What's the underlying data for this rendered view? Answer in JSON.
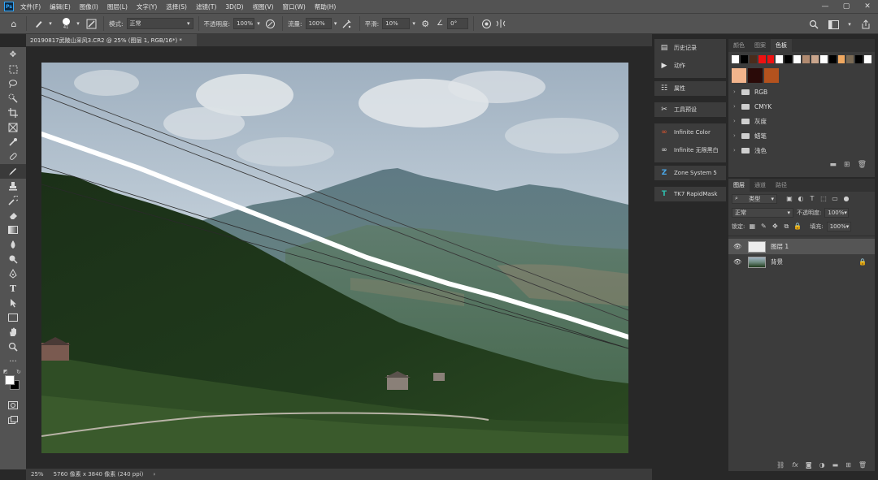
{
  "menubar": {
    "logo": "Ps",
    "items": [
      "文件(F)",
      "编辑(E)",
      "图像(I)",
      "图层(L)",
      "文字(Y)",
      "选择(S)",
      "滤镜(T)",
      "3D(D)",
      "视图(V)",
      "窗口(W)",
      "帮助(H)"
    ],
    "window_controls": [
      "—",
      "▢",
      "✕"
    ]
  },
  "options": {
    "brush_size": "41",
    "mode_label": "模式:",
    "mode_value": "正常",
    "opacity_label": "不透明度:",
    "opacity_value": "100%",
    "flow_label": "流量:",
    "flow_value": "100%",
    "smooth_label": "平滑:",
    "smooth_value": "10%",
    "angle_value": "0°"
  },
  "document": {
    "tab_title": "20190817武陵山采风3.CR2 @ 25% (图层 1, RGB/16*) *",
    "zoom": "25%",
    "info": "5760 像素 x 3840 像素 (240 ppi)"
  },
  "dock": {
    "history": "历史记录",
    "actions": "动作",
    "properties": "属性",
    "tool_presets": "工具预设",
    "infinite_color": "Infinite Color",
    "infinite_bw": "Infinite 无限黑白",
    "zone_system": "Zone System 5",
    "tk7": "TK7 RapidMask"
  },
  "swatches_panel": {
    "tabs": [
      "颜色",
      "图案",
      "色板"
    ],
    "active_tab": 2,
    "row": [
      "#ffffff",
      "#000000",
      "#4a2c1c",
      "#ee1111",
      "#ee1111",
      "#ffffff",
      "#000000",
      "#ffffff",
      "#b08a70",
      "#c9a58c",
      "#ffffff",
      "#000000",
      "#f0a860",
      "#7a6a55",
      "#000000",
      "#ffffff"
    ],
    "recent": [
      "#f2b48c",
      "#2a0a08",
      "#b4521e"
    ],
    "folders": [
      "RGB",
      "CMYK",
      "灰度",
      "蜡笔",
      "浅色"
    ]
  },
  "layers_panel": {
    "tabs": [
      "图层",
      "通道",
      "路径"
    ],
    "filter_kind": "类型",
    "blend_mode": "正常",
    "opacity_label": "不透明度:",
    "opacity_value": "100%",
    "lock_label": "锁定:",
    "fill_label": "填充:",
    "fill_value": "100%",
    "layers": [
      {
        "name": "图层 1",
        "selected": true
      },
      {
        "name": "背景",
        "selected": false
      }
    ]
  }
}
